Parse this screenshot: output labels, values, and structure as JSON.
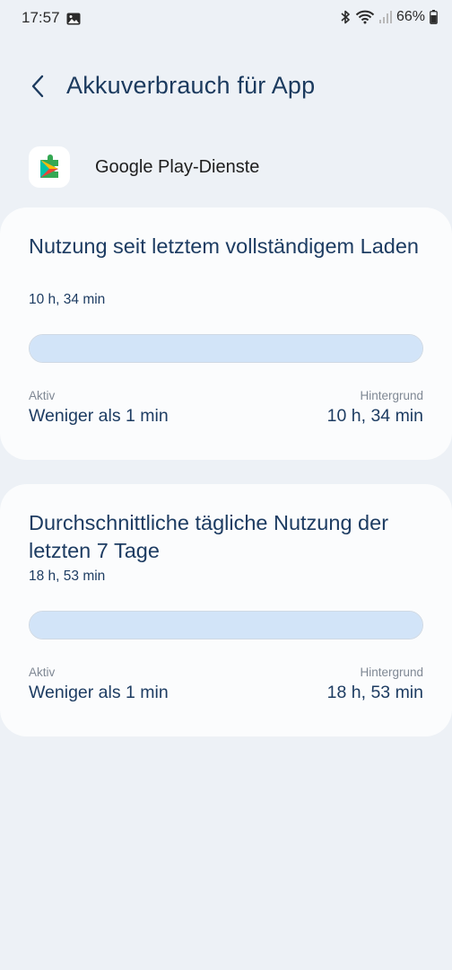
{
  "status_bar": {
    "time": "17:57",
    "battery": "66%",
    "icons": [
      "gallery-icon",
      "bluetooth-icon",
      "wifi-icon",
      "signal-icon",
      "battery-icon"
    ]
  },
  "header": {
    "back_icon": "chevron-left-icon",
    "title": "Akkuverbrauch für App"
  },
  "app": {
    "icon": "google-play-services-icon",
    "name": "Google Play-Dienste"
  },
  "cards": [
    {
      "title": "Nutzung seit letztem vollständigem Laden",
      "total": "10 h, 34 min",
      "active_fraction": 0.0,
      "active_label": "Aktiv",
      "active_value": "Weniger als 1 min",
      "background_label": "Hintergrund",
      "background_value": "10 h, 34 min"
    },
    {
      "title": "Durchschnittliche tägliche Nutzung der letzten 7 Tage",
      "total": "18 h, 53 min",
      "active_fraction": 0.0,
      "active_label": "Aktiv",
      "active_value": "Weniger als 1 min",
      "background_label": "Hintergrund",
      "background_value": "18 h, 53 min"
    }
  ],
  "colors": {
    "background": "#edf1f6",
    "card": "#fbfcfd",
    "title_text": "#1b3a5e",
    "background_usage": "#d2e4f8"
  }
}
